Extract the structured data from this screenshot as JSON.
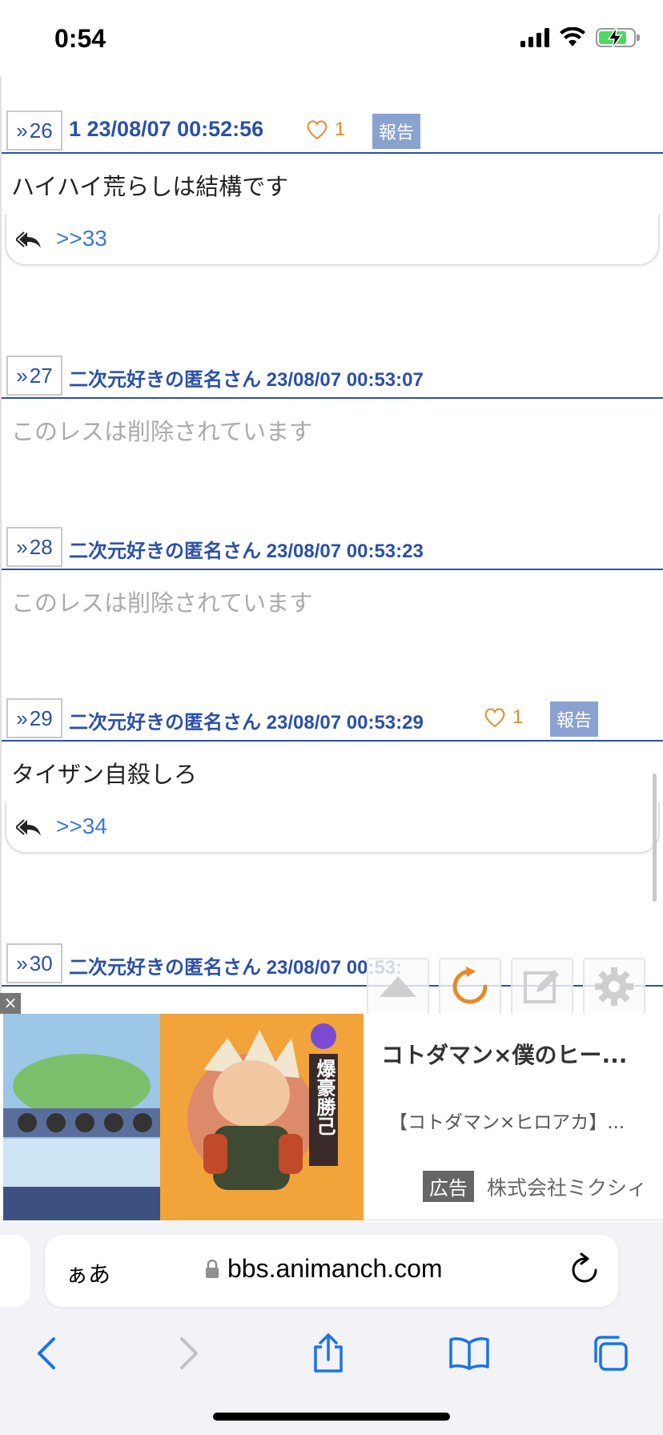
{
  "status_bar": {
    "time": "0:54"
  },
  "posts": [
    {
      "num": "26",
      "meta": "1 23/08/07 00:52:56",
      "likes": "1",
      "report": "報告",
      "body": "ハイハイ荒らしは結構です",
      "reply": ">>33"
    },
    {
      "num": "27",
      "meta": "二次元好きの匿名さん 23/08/07 00:53:07",
      "body": "このレスは削除されています"
    },
    {
      "num": "28",
      "meta": "二次元好きの匿名さん 23/08/07 00:53:23",
      "body": "このレスは削除されています"
    },
    {
      "num": "29",
      "meta": "二次元好きの匿名さん 23/08/07 00:53:29",
      "likes": "1",
      "report": "報告",
      "body": "タイザン自殺しろ",
      "reply": ">>34"
    },
    {
      "num": "30",
      "meta": "二次元好きの匿名さん 23/08/07 00:53:"
    }
  ],
  "ad": {
    "close": "×",
    "title": "コトダマン×僕のヒー...",
    "description": "【コトダマン×ヒロアカ】...",
    "badge": "広告",
    "sponsor": "株式会社ミクシィ",
    "image_text": "爆豪勝己"
  },
  "browser": {
    "aa": "ぁあ",
    "url": "bbs.animanch.com"
  },
  "colors": {
    "link_blue": "#2b50a8",
    "like_orange": "#e58a2a",
    "report_bg": "#8aa2d0"
  }
}
